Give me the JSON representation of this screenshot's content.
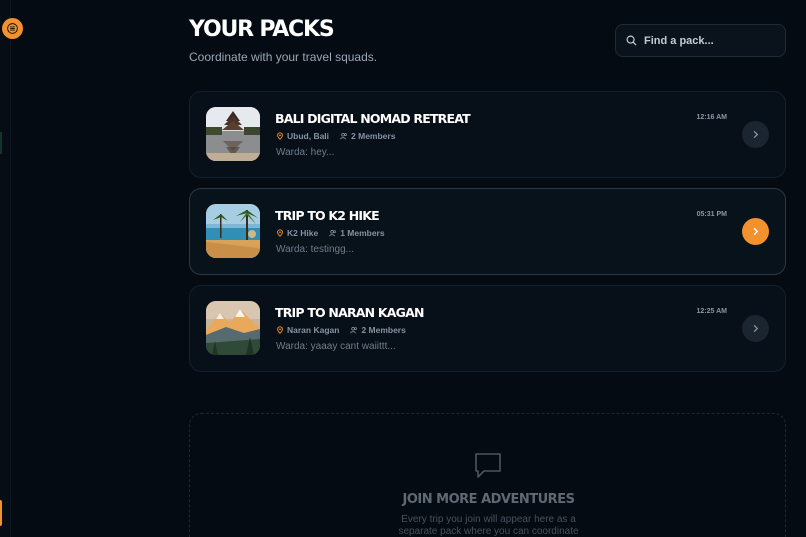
{
  "header": {
    "title": "YOUR PACKS",
    "subtitle": "Coordinate with your travel squads."
  },
  "search": {
    "placeholder": "Find a pack..."
  },
  "menu": {
    "icon": "menu-icon"
  },
  "colors": {
    "accent": "#f2912e",
    "background": "#050b12",
    "card": "#071019"
  },
  "packs": [
    {
      "title": "BALI DIGITAL NOMAD RETREAT",
      "location": "Ubud, Bali",
      "members": "2 Members",
      "last_message": "Warda: hey...",
      "time": "12:16 AM",
      "active": false
    },
    {
      "title": "TRIP TO K2 HIKE",
      "location": "K2 Hike",
      "members": "1 Members",
      "last_message": "Warda: testingg...",
      "time": "05:31 PM",
      "active": true
    },
    {
      "title": "TRIP TO NARAN KAGAN",
      "location": "Naran Kagan",
      "members": "2 Members",
      "last_message": "Warda: yaaay cant waiittt...",
      "time": "12:25 AM",
      "active": false
    }
  ],
  "join": {
    "title": "JOIN MORE ADVENTURES",
    "text": "Every trip you join will appear here as a separate pack where you can coordinate"
  }
}
